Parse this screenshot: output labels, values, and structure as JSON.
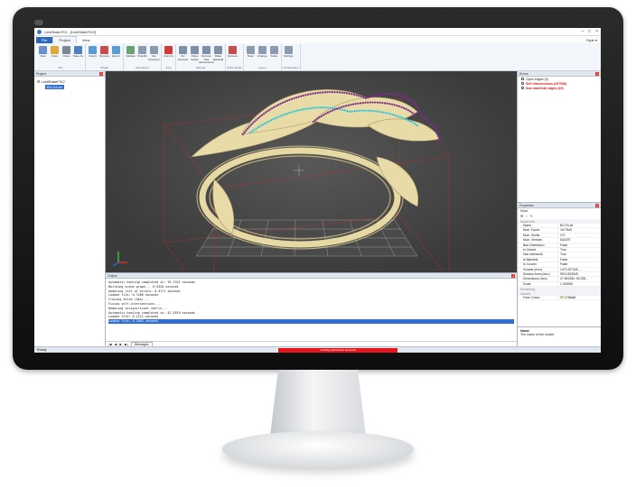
{
  "window": {
    "title": "LimitState:FIX - [LimitStateFIX2]"
  },
  "tabs": [
    "File",
    "Project",
    "View"
  ],
  "style_label": "Style ▾",
  "ribbon": {
    "groups": [
      {
        "name": "File",
        "buttons": [
          [
            "New",
            "#6a8fc9"
          ],
          [
            "Open",
            "#e0a83a"
          ],
          [
            "Close",
            "#7c8899"
          ],
          [
            "Save As",
            "#4f7ec4"
          ]
        ]
      },
      {
        "name": "Model",
        "buttons": [
          [
            "Import",
            "#5a9bd5"
          ],
          [
            "Remove",
            "#c94c4c"
          ],
          [
            "Export",
            "#5a9bd5"
          ]
        ]
      },
      {
        "name": "Operations",
        "buttons": [
          [
            "Validate",
            "#6aa36f"
          ],
          [
            "Simplify",
            "#8d9bb0"
          ],
          [
            "Set Precision",
            "#8d9bb0"
          ]
        ]
      },
      {
        "name": "Auto",
        "buttons": [
          [
            "Auto Fix",
            "#d23a3a"
          ]
        ]
      },
      {
        "name": "Manual",
        "buttons": [
          [
            "Fix Normals",
            "#7e8fa8"
          ],
          [
            "Close Solids",
            "#7e8fa8"
          ],
          [
            "Remove Self Intersections",
            "#7e8fa8"
          ],
          [
            "Make Manifold",
            "#7e8fa8"
          ]
        ]
      },
      {
        "name": "Noise Shells",
        "buttons": [
          [
            "Remove",
            "#c94c4c"
          ]
        ]
      },
      {
        "name": "Layout",
        "buttons": [
          [
            "Snap",
            "#8d9bb0"
          ],
          [
            "Arrange",
            "#8d9bb0"
          ],
          [
            "Scale",
            "#8d9bb0"
          ]
        ]
      },
      {
        "name": "Configuration",
        "buttons": [
          [
            "Settings",
            "#8d9bb0"
          ]
        ]
      }
    ]
  },
  "project": {
    "header": "Project",
    "root": "LimitStateFIX2",
    "item": "BG-94.stl"
  },
  "errors": {
    "header": "Errors",
    "items": [
      {
        "label": "Open edges (0)",
        "red": false
      },
      {
        "label": "Self intersections (167930)",
        "red": true
      },
      {
        "label": "Non manifold edges (20)",
        "red": true
      }
    ]
  },
  "properties": {
    "header": "Properties",
    "subtitle": "Solid",
    "section_model": "Model Info",
    "section_render": "Rendering",
    "default_label": "Default",
    "rows": [
      [
        "Name",
        "BG-94.stl"
      ],
      [
        "Num. Faces",
        "1677840"
      ],
      [
        "Num. Shells",
        "271"
      ],
      [
        "Num. Vertices",
        "831879"
      ],
      [
        "Bad Orientation",
        "False"
      ],
      [
        "Is Closed",
        "True"
      ],
      [
        "Has Intersects",
        "True"
      ],
      [
        "Is Manifold",
        "False"
      ],
      [
        "Is Convex",
        "False"
      ],
      [
        "Volume (mm³)",
        "1470.327345 ..."
      ],
      [
        "Surface Area (mm²)",
        "9913.823949"
      ],
      [
        "Dimensions (mm)",
        "47.891350, 50.035..."
      ],
      [
        "Scale",
        "1.000000"
      ]
    ],
    "face_colour": [
      "Face Colour",
      "#768a6f"
    ],
    "desc_title": "Name",
    "desc_text": "The name of the model."
  },
  "output": {
    "header": "Output",
    "lines": [
      "Automatic healing completed in: 76.2701 seconds",
      "Building scene graph...  0.5320 seconds",
      "Updating list of errors: 0.3171 seconds",
      "Loaded file: 0.7466 seconds",
      "Closing solid (Ops)...",
      "Fixing self-intersections...",
      "Removing insignificant shells...",
      "Automatic healing completed in: 42.5919 seconds",
      "Loaded file: 0.2211 seconds",
      "Loaded file: 0.2003 seconds"
    ],
    "tab": "Messages"
  },
  "status": {
    "ready": "Ready",
    "progress": "Locating intersected elements"
  }
}
